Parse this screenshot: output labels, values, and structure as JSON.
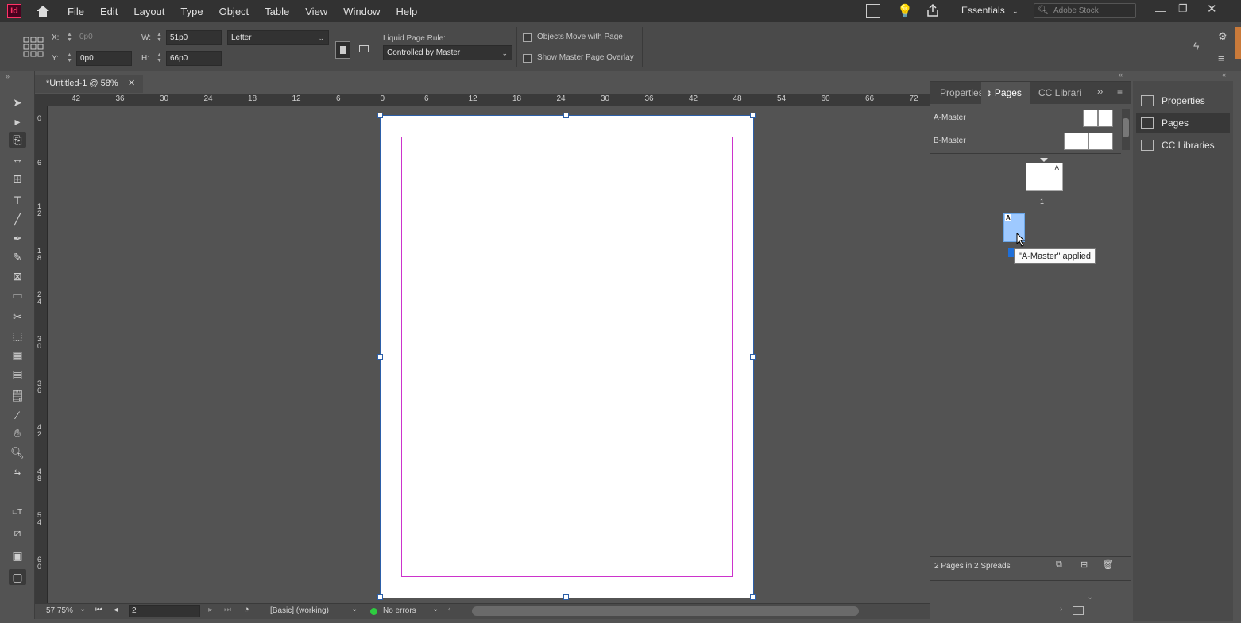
{
  "app": {
    "icon_label": "Id"
  },
  "menu": {
    "items": [
      "File",
      "Edit",
      "Layout",
      "Type",
      "Object",
      "Table",
      "View",
      "Window",
      "Help"
    ]
  },
  "topbar": {
    "workspace": "Essentials",
    "search_placeholder": "Adobe Stock"
  },
  "control": {
    "x_label": "X:",
    "x_value": "0p0",
    "y_label": "Y:",
    "y_value": "0p0",
    "w_label": "W:",
    "w_value": "51p0",
    "h_label": "H:",
    "h_value": "66p0",
    "page_size": "Letter",
    "liquid_label": "Liquid Page Rule:",
    "liquid_value": "Controlled by Master",
    "objects_move": "Objects Move with Page",
    "show_overlay": "Show Master Page Overlay"
  },
  "document": {
    "tab_title": "*Untitled-1 @ 58%"
  },
  "ruler": {
    "h": [
      "42",
      "36",
      "30",
      "24",
      "18",
      "12",
      "6",
      "0",
      "6",
      "12",
      "18",
      "24",
      "30",
      "36",
      "42",
      "48",
      "54",
      "60",
      "66",
      "72"
    ],
    "v": [
      "0",
      "6",
      "1\n2",
      "1\n8",
      "2\n4",
      "3\n0",
      "3\n6",
      "4\n2",
      "4\n8",
      "5\n4",
      "6\n0"
    ]
  },
  "status": {
    "zoom": "57.75%",
    "page": "2",
    "style": "[Basic] (working)",
    "errors": "No errors"
  },
  "pages_panel": {
    "tabs": [
      "Properties",
      "Pages",
      "CC Librari"
    ],
    "masters": [
      "A-Master",
      "B-Master"
    ],
    "page1_number": "1",
    "page1_master": "A",
    "page2_master": "A",
    "tooltip": "\"A-Master\" applied",
    "footer": "2 Pages in 2 Spreads"
  },
  "right_panel": {
    "items": [
      "Properties",
      "Pages",
      "CC Libraries"
    ]
  },
  "colors": {
    "accent": "#2c5fa8",
    "margin": "#cc33cc",
    "selected_page": "#9ec9ff",
    "ok_status": "#2ecc40"
  }
}
